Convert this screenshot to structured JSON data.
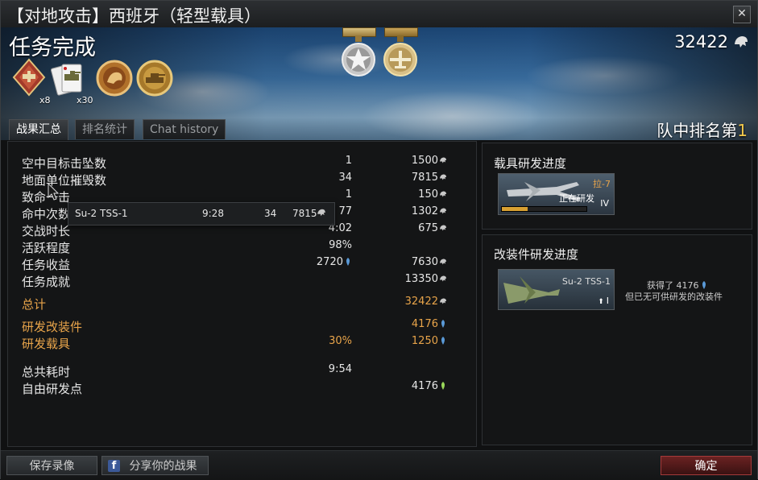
{
  "window": {
    "title": "【对地攻击】西班牙（轻型载具）",
    "close_label": "✕"
  },
  "banner": {
    "mission_title": "任务完成",
    "score": "32422",
    "rank_label": "队中排名第",
    "rank_value": "1",
    "awards": [
      {
        "name": "ground-attack-award-icon",
        "count": "x8"
      },
      {
        "name": "tank-cards-award-icon",
        "count": "x30"
      },
      {
        "name": "lion-medal-icon",
        "count": ""
      },
      {
        "name": "tank-medal-icon",
        "count": ""
      }
    ]
  },
  "tabs": [
    {
      "label": "战果汇总",
      "active": true
    },
    {
      "label": "排名统计",
      "active": false
    },
    {
      "label": "Chat history",
      "active": false
    }
  ],
  "stats": {
    "rows": [
      {
        "label": "空中目标击坠数",
        "mid": "1",
        "right": "1500",
        "icon": "lion",
        "style": ""
      },
      {
        "label": "地面单位摧毁数",
        "mid": "34",
        "right": "7815",
        "icon": "lion",
        "style": ""
      },
      {
        "label": "致命一击",
        "mid": "1",
        "right": "150",
        "icon": "lion",
        "style": ""
      },
      {
        "label": "命中次数",
        "mid": "77",
        "right": "1302",
        "icon": "lion",
        "style": ""
      },
      {
        "label": "交战时长",
        "mid": "4:02",
        "right": "675",
        "icon": "lion",
        "style": ""
      },
      {
        "label": "活跃程度",
        "mid": "98%",
        "right": "",
        "icon": "",
        "style": ""
      },
      {
        "label": "任务收益",
        "mid": "2720",
        "mid_icon": "rp",
        "right": "7630",
        "icon": "lion",
        "style": ""
      },
      {
        "label": "任务成就",
        "mid": "",
        "right": "13350",
        "icon": "lion",
        "style": ""
      },
      {
        "label": "总计",
        "mid": "",
        "right": "32422",
        "icon": "lion",
        "style": "orange"
      },
      {
        "label": "研发改装件",
        "mid": "",
        "right": "4176",
        "icon": "rp",
        "style": "orange"
      },
      {
        "label": "研发载具",
        "mid": "30%",
        "right": "1250",
        "icon": "rp",
        "style": "orange"
      },
      {
        "label": "总共耗时",
        "mid": "9:54",
        "right": "",
        "icon": "",
        "style": ""
      },
      {
        "label": "自由研发点",
        "mid": "",
        "right": "4176",
        "icon": "frp",
        "style": ""
      }
    ]
  },
  "tooltip": {
    "vehicle": "Su-2 TSS-1",
    "time": "9:28",
    "kills": "34",
    "score": "7815"
  },
  "vehicle_research": {
    "title": "载具研发进度",
    "vehicle_name": "拉-7",
    "status": "正在研发",
    "rank": "IV",
    "progress": 0.3
  },
  "modification_research": {
    "title": "改装件研发进度",
    "vehicle_name": "Su-2 TSS-1",
    "rank": "I",
    "earned_label": "获得了 4176",
    "note": "但已无可供研发的改装件"
  },
  "bottom": {
    "save_replay": "保存录像",
    "share": "分享你的战果",
    "confirm": "确定"
  },
  "colors": {
    "accent_orange": "#e8a44a",
    "rp_blue": "#5a9ad8",
    "frp_green": "#9ad85a",
    "confirm_red": "#6a2222"
  }
}
